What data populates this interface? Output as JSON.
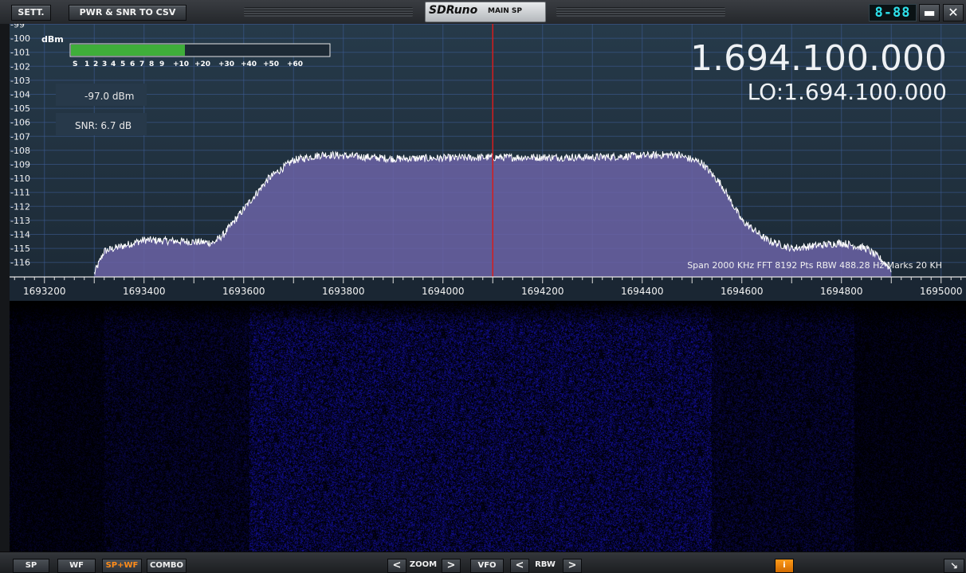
{
  "titlebar": {
    "settings_label": "SETT.",
    "export_label": "PWR & SNR TO CSV",
    "app_name": "SDRuno",
    "window_name": "MAIN SP",
    "led_display": "8-88",
    "minimize_label": "▬",
    "close_label": "✕"
  },
  "spectrum": {
    "unit_label": "dBm",
    "db_levels": [
      "-99",
      "-100",
      "-101",
      "-102",
      "-103",
      "-104",
      "-105",
      "-106",
      "-107",
      "-108",
      "-109",
      "-110",
      "-111",
      "-112",
      "-113",
      "-114",
      "-115",
      "-116"
    ],
    "smeter_scale": [
      "S",
      "1",
      "2",
      "3",
      "4",
      "5",
      "6",
      "7",
      "8",
      "9",
      "+10",
      "+20",
      "+30",
      "+40",
      "+50",
      "+60"
    ],
    "smeter_fill_fraction": 0.44,
    "power_readout": "-97.0 dBm",
    "snr_readout": "SNR: 6.7 dB",
    "frequency": "1.694.100.000",
    "lo_frequency": "LO:1.694.100.000",
    "info_line": "Span 2000 KHz  FFT 8192 Pts  RBW 488.28 Hz  Marks 20 KH",
    "freq_ticks": [
      "1693200",
      "1693400",
      "1693600",
      "1693800",
      "1694000",
      "1694200",
      "1694400",
      "1694600",
      "1694800",
      "1695000"
    ],
    "colors": {
      "signal_fill": "#6b63a6",
      "signal_line": "#ffffff",
      "center_marker": "#d41d1d",
      "smeter_fill": "#3fae3a",
      "grid": "#3f5f9a"
    }
  },
  "chart_data": {
    "type": "area",
    "title": "",
    "xlabel": "",
    "ylabel": "dBm",
    "xlim": [
      1693130,
      1695050
    ],
    "ylim": [
      -116.7,
      -98.9
    ],
    "x": [
      1693300,
      1693320,
      1693400,
      1693480,
      1693540,
      1693560,
      1693600,
      1693650,
      1693700,
      1693760,
      1693900,
      1694100,
      1694300,
      1694470,
      1694520,
      1694560,
      1694600,
      1694650,
      1694700,
      1694800,
      1694850,
      1694880,
      1694900
    ],
    "series": [
      {
        "values": [
          -116.8,
          -115.2,
          -114.4,
          -114.5,
          -114.6,
          -114.0,
          -112.2,
          -110.0,
          -108.7,
          -108.3,
          -108.6,
          -108.5,
          -108.5,
          -108.3,
          -108.9,
          -110.5,
          -113.0,
          -114.4,
          -115.0,
          -114.6,
          -115.0,
          -115.8,
          -116.5
        ]
      }
    ]
  },
  "bottom": {
    "sp_label": "SP",
    "wf_label": "WF",
    "spwf_label": "SP+WF",
    "combo_label": "COMBO",
    "zoom_prev": "<",
    "zoom_label": "ZOOM",
    "zoom_next": ">",
    "vfo_label": "VFO",
    "rbw_prev": "<",
    "rbw_label": "RBW",
    "rbw_next": ">",
    "info_label": "i",
    "resize_label": "↘"
  }
}
